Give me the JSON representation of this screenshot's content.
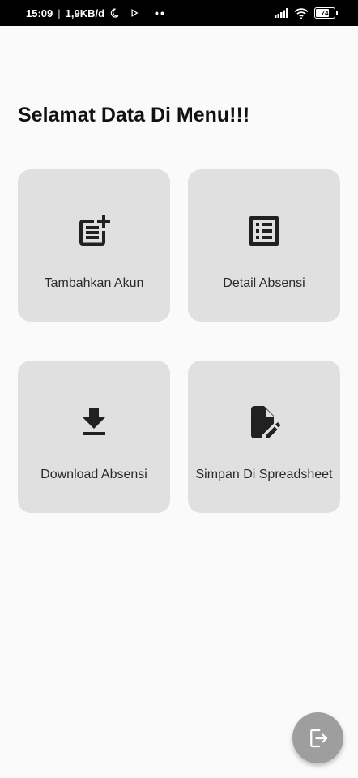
{
  "status_bar": {
    "time": "15:09",
    "separator": "|",
    "network_speed": "1,9KB/d",
    "dots": "••",
    "battery_level": "74",
    "battery_percent": 74
  },
  "page": {
    "title": "Selamat Data Di Menu!!!"
  },
  "menu": {
    "items": [
      {
        "label": "Tambahkan Akun",
        "icon": "post-add-icon"
      },
      {
        "label": "Detail Absensi",
        "icon": "list-alt-icon"
      },
      {
        "label": "Download Absensi",
        "icon": "download-icon"
      },
      {
        "label": "Simpan Di Spreadsheet",
        "icon": "edit-document-icon"
      }
    ]
  },
  "fab": {
    "icon": "logout-icon"
  },
  "colors": {
    "background": "#fafafa",
    "card": "#e0e0e0",
    "icon": "#212121",
    "fab": "#9e9e9e"
  }
}
